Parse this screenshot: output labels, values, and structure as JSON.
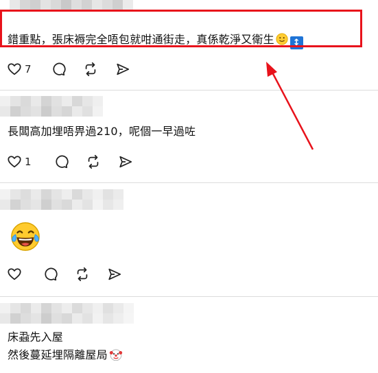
{
  "comments": [
    {
      "text": "錯重點，張床褥完全唔包就咁通街走，真係乾淨又衛生",
      "emoji": [
        "slightly-smiling-face",
        "up-down-arrow"
      ],
      "likes": "7"
    },
    {
      "text": "長闆高加埋唔畀過210，呢個一早過咗",
      "likes": "1"
    },
    {
      "emoji": [
        "face-with-tears-of-joy"
      ],
      "likes": ""
    },
    {
      "lines": [
        "床蝨先入屋",
        "然後蔓延埋隔離屋局"
      ],
      "emoji": [
        "clown-face"
      ]
    }
  ],
  "icons": {
    "like": "heart-icon",
    "reply": "comment-icon",
    "repost": "repost-icon",
    "share": "send-icon"
  },
  "colors": {
    "highlight": "#e8121b",
    "arrow": "#e8121b",
    "updown_badge": "#1f74d6",
    "divider": "#dcdcdc"
  }
}
